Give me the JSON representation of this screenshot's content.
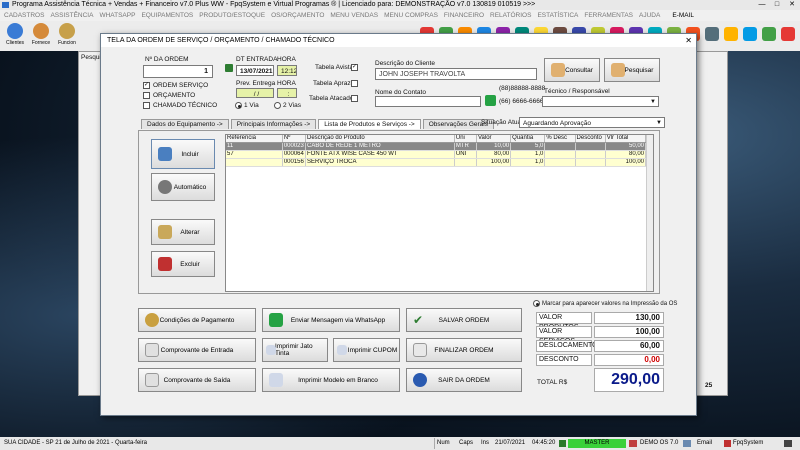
{
  "app": {
    "title": "Programa Assistência Técnica + Vendas + Financeiro v7.0 Plus WW - FpqSystem e Virtual Programas ® | Licenciado para: DEMONSTRAÇÃO v7.0 130819 010519 >>>",
    "window_controls": [
      "—",
      "□",
      "✕"
    ]
  },
  "menubar": {
    "items": [
      "CADASTROS",
      "ASSISTÊNCIA",
      "WHATSAPP",
      "EQUIPAMENTOS",
      "PRODUTO/ESTOQUE",
      "OS/ORÇAMENTO",
      "MENU VENDAS",
      "MENU COMPRAS",
      "FINANCEIRO",
      "RELATÓRIOS",
      "ESTATÍSTICA",
      "FERRAMENTAS",
      "AJUDA"
    ],
    "email": "E-MAIL"
  },
  "toolbar": {
    "buttons": [
      {
        "label": "Clientes",
        "color": "#3a7bd5"
      },
      {
        "label": "Fornece",
        "color": "#d58a3a"
      },
      {
        "label": "Funcion",
        "color": "#c7a04a"
      }
    ],
    "icon_colors": [
      "#e53935",
      "#43a047",
      "#fb8c00",
      "#1e88e5",
      "#8e24aa",
      "#00897b",
      "#fdd835",
      "#6d4c41",
      "#3949ab",
      "#c0ca33",
      "#d81b60",
      "#5e35b1",
      "#00acc1",
      "#7cb342",
      "#f4511e",
      "#546e7a",
      "#ffb300",
      "#039be5",
      "#43a047",
      "#e53935",
      "#1e88e5",
      "#fb8c00"
    ]
  },
  "backwin": {
    "tab_label": "Pesqui"
  },
  "dialog": {
    "title": "TELA DA ORDEM DE SERVIÇO / ORÇAMENTO / CHAMADO TÉCNICO",
    "close": "✕",
    "os_number_label": "Nº DA ORDEM",
    "os_number": "1",
    "type_options": [
      {
        "label": "ORDEM SERVIÇO",
        "checked": true
      },
      {
        "label": "ORÇAMENTO",
        "checked": false
      },
      {
        "label": "CHAMADO TÉCNICO",
        "checked": false
      }
    ],
    "dt_entrada_label": "DT ENTRADA",
    "dt_entrada": "13/07/2021",
    "hora_label": "HORA",
    "hora": "12:12",
    "prev_entrega_label": "Prev. Entrega",
    "prev_entrega": "/ /",
    "hora2_label": "HORA",
    "hora2": ":",
    "via_options": [
      {
        "label": "1 Via",
        "selected": true
      },
      {
        "label": "2 Vias",
        "selected": false
      }
    ],
    "tabela_options": [
      {
        "label": "Tabela Avista",
        "checked": true
      },
      {
        "label": "Tabela Aprazo",
        "checked": false
      },
      {
        "label": "Tabela Atacado",
        "checked": false
      }
    ],
    "cliente_label": "Descrição do Cliente",
    "cliente": "JOHN JOSEPH TRAVOLTA",
    "contato_label": "Nome do Contato",
    "contato": "",
    "phone1": "(88)88888-8888",
    "phone2": "(66) 6666-6666",
    "consultar_label": "Consultar",
    "pesquisar_label": "Pesquisar",
    "tecnico_label": "Técnico / Responsável",
    "tecnico": "",
    "tabs": [
      "Dados do Equipamento ->",
      "Principais Informações ->",
      "Lista de Produtos e Serviços ->",
      "Observações Gerais"
    ],
    "situacao_label": "Situação Atual",
    "situacao": "Aguardando Aprovação",
    "side_buttons": {
      "incluir": "Incluir",
      "automatico": "Automático",
      "alterar": "Alterar",
      "excluir": "Excluir"
    },
    "grid": {
      "columns": [
        "Referencia",
        "Nº",
        "Descrição do Produto",
        "Uni",
        "Valor",
        "Quantia",
        "% Desc",
        "Desconto",
        "Vlr Total"
      ],
      "rows": [
        [
          "11",
          "000023",
          "CABO DE REDE 1 METRO",
          "MTR",
          "10,00",
          "5,0",
          "",
          "",
          "50,00"
        ],
        [
          "57",
          "000064",
          "FONTE ATX WISE CASE 450 WT",
          "UNI",
          "80,00",
          "1,0",
          "",
          "",
          "80,00"
        ],
        [
          "",
          "000156",
          "SERVIÇO TROCA",
          "",
          "100,00",
          "1,0",
          "",
          "",
          "100,00"
        ]
      ]
    },
    "bottom_buttons": {
      "condicoes": "Condições de Pagamento",
      "whatsapp": "Enviar Mensagem via WhatsApp",
      "salvar": "SALVAR ORDEM",
      "comp_entrada": "Comprovante de Entrada",
      "jato": "Imprimir Jato Tinta",
      "cupom": "Imprimir CUPOM",
      "finalizar": "FINALIZAR ORDEM",
      "comp_saida": "Comprovante de Saída",
      "modelo_branco": "Imprimir Modelo em Branco",
      "sair": "SAIR DA ORDEM"
    },
    "marcar_label": "Marcar para aparecer valores na Impressão da OS",
    "totals": [
      {
        "label": "VALOR PRODUTOS",
        "value": "130,00",
        "color": "#000000"
      },
      {
        "label": "VALOR SERVIÇOS",
        "value": "100,00",
        "color": "#000000"
      },
      {
        "label": "DESLOCAMENTO",
        "value": "60,00",
        "color": "#000000"
      },
      {
        "label": "DESCONTO",
        "value": "0,00",
        "color": "#d00000"
      }
    ],
    "total_label": "TOTAL R$",
    "total_value": "290,00",
    "total_color": "#0a1a8a"
  },
  "right_edge_number": "25",
  "statusbar": {
    "city": "SUA CIDADE - SP 21 de Julho de 2021 - Quarta-feira",
    "num": "Num",
    "caps": "Caps",
    "ins": "Ins",
    "date": "21/07/2021",
    "time": "04:45:20",
    "master": "MASTER",
    "version": "DEMO OS 7.0",
    "email": "Email",
    "brand": "FpqSystem"
  }
}
